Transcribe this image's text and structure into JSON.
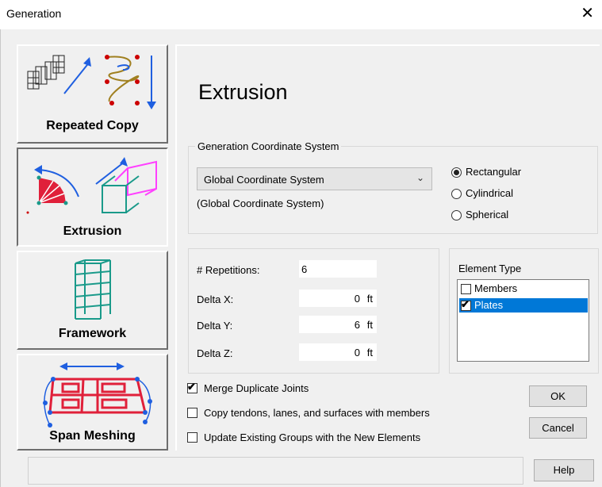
{
  "window": {
    "title": "Generation",
    "close_glyph": "✕"
  },
  "nav": {
    "repeated_copy": "Repeated Copy",
    "extrusion": "Extrusion",
    "framework": "Framework",
    "span_meshing": "Span Meshing",
    "active": "Extrusion"
  },
  "page_title": "Extrusion",
  "coord_system": {
    "group_label": "Generation Coordinate System",
    "selected": "Global Coordinate System",
    "description": "(Global Coordinate System)",
    "options": [
      {
        "label": "Rectangular",
        "selected": true
      },
      {
        "label": "Cylindrical",
        "selected": false
      },
      {
        "label": "Spherical",
        "selected": false
      }
    ]
  },
  "params": {
    "repetitions_label": "# Repetitions:",
    "repetitions": "6",
    "dx_label": "Delta X:",
    "dx": "0",
    "dy_label": "Delta Y:",
    "dy": "6",
    "dz_label": "Delta Z:",
    "dz": "0",
    "unit": "ft"
  },
  "element_type": {
    "group_label": "Element Type",
    "items": [
      {
        "label": "Members",
        "checked": false
      },
      {
        "label": "Plates",
        "checked": true
      }
    ]
  },
  "options": {
    "merge": {
      "label": "Merge Duplicate Joints",
      "checked": true
    },
    "copy_tendons": {
      "label": "Copy tendons, lanes, and surfaces with members",
      "checked": false
    },
    "update_groups": {
      "label": "Update Existing Groups with the New Elements",
      "checked": false
    }
  },
  "buttons": {
    "ok": "OK",
    "cancel": "Cancel",
    "help": "Help"
  },
  "colors": {
    "accent": "#0078d7",
    "icon_red": "#e0203a",
    "icon_teal": "#1a9a8a",
    "icon_blue": "#1f5fe0",
    "icon_magenta": "#ff40ff"
  }
}
